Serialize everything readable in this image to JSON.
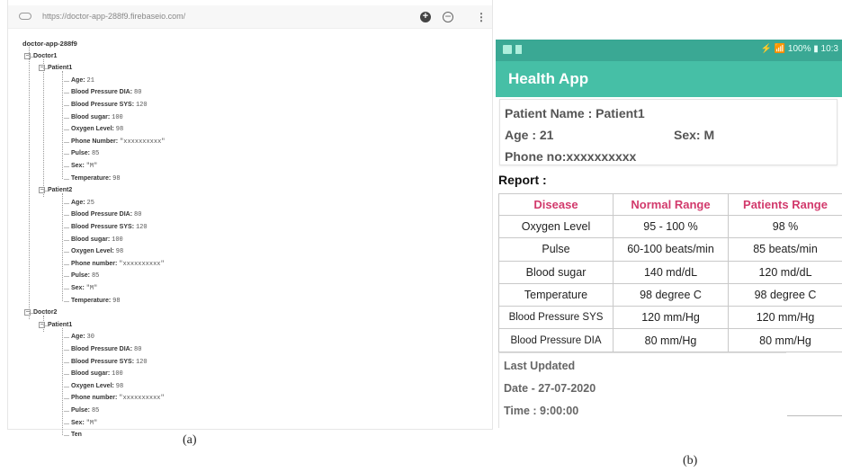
{
  "firebase": {
    "url": "https://doctor-app-288f9.firebaseio.com/",
    "root": "doctor-app-288f9",
    "doctor1": "Doctor1",
    "d1_patient1": "Patient1",
    "d1_patient2": "Patient2",
    "doctor2": "Doctor2",
    "d2_patient1": "Patient1",
    "fields_d1p1": [
      {
        "k": "Age: ",
        "v": "21"
      },
      {
        "k": "Blood Pressure DIA: ",
        "v": "80"
      },
      {
        "k": "Blood Pressure SYS: ",
        "v": "120"
      },
      {
        "k": "Blood sugar: ",
        "v": "100"
      },
      {
        "k": "Oxygen Level: ",
        "v": "98"
      },
      {
        "k": "Phone Number: ",
        "v": "\"xxxxxxxxxx\""
      },
      {
        "k": "Pulse: ",
        "v": "85"
      },
      {
        "k": "Sex: ",
        "v": "\"M\""
      },
      {
        "k": "Temperature: ",
        "v": "98"
      }
    ],
    "fields_d1p2": [
      {
        "k": "Age: ",
        "v": "25"
      },
      {
        "k": "Blood Pressure DIA: ",
        "v": "80"
      },
      {
        "k": "Blood Pressure SYS: ",
        "v": "120"
      },
      {
        "k": "Blood sugar: ",
        "v": "100"
      },
      {
        "k": "Oxygen Level: ",
        "v": "98"
      },
      {
        "k": "Phone number: ",
        "v": "\"xxxxxxxxxx\""
      },
      {
        "k": "Pulse: ",
        "v": "85"
      },
      {
        "k": "Sex: ",
        "v": "\"M\""
      },
      {
        "k": "Temperature: ",
        "v": "98"
      }
    ],
    "fields_d2p1": [
      {
        "k": "Age: ",
        "v": "30"
      },
      {
        "k": "Blood Pressure DIA: ",
        "v": "80"
      },
      {
        "k": "Blood Pressure SYS: ",
        "v": "120"
      },
      {
        "k": "Blood sugar: ",
        "v": "100"
      },
      {
        "k": "Oxygen Level: ",
        "v": "98"
      },
      {
        "k": "Phone number: ",
        "v": "\"xxxxxxxxxx\""
      },
      {
        "k": "Pulse: ",
        "v": "85"
      },
      {
        "k": "Sex: ",
        "v": "\"M\""
      },
      {
        "k": "Ten",
        "v": ""
      }
    ],
    "caption": "(a)"
  },
  "phone": {
    "status_right": "⚡ 📶 100% ▮ 10:3",
    "app_title": "Health App",
    "patient_name": "Patient Name : Patient1",
    "age": "Age  :  21",
    "sex": "Sex: M",
    "phone_no": "Phone no:xxxxxxxxxx",
    "report_label": "Report :",
    "table_headers": [
      "Disease",
      "Normal Range",
      "Patients Range"
    ],
    "table_rows": [
      [
        "Oxygen Level",
        "95 - 100 %",
        "98 %"
      ],
      [
        "Pulse",
        "60-100 beats/min",
        "85 beats/min"
      ],
      [
        "Blood sugar",
        "140 md/dL",
        "120 md/dL"
      ],
      [
        "Temperature",
        "98 degree C",
        "98 degree C"
      ],
      [
        "Blood Pressure SYS",
        "120 mm/Hg",
        "120 mm/Hg"
      ],
      [
        "Blood Pressure DIA",
        "80 mm/Hg",
        "80 mm/Hg"
      ]
    ],
    "last_updated": "Last Updated",
    "date": "Date - 27-07-2020",
    "time": "Time :  9:00:00",
    "caption": "(b)",
    "colors": {
      "status": "#3aa894",
      "appbar": "#46bfa6",
      "header_text": "#d23a6c"
    }
  }
}
